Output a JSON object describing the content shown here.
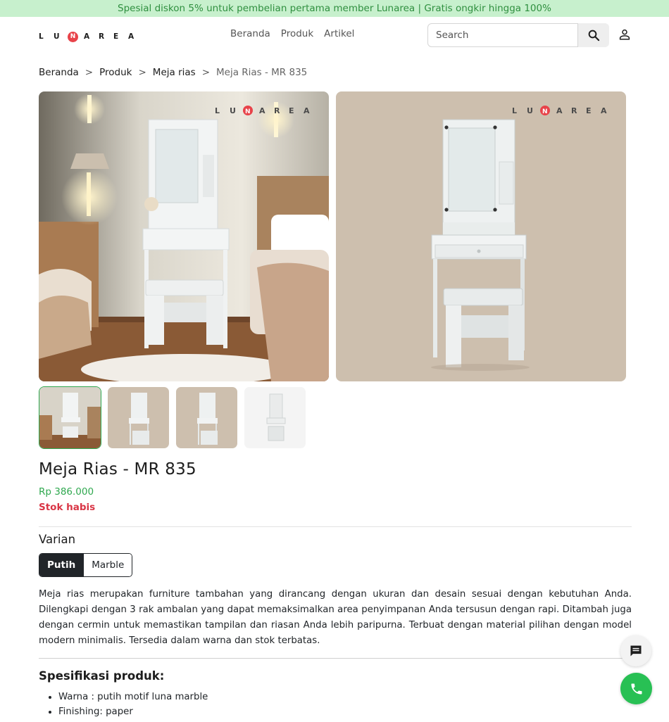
{
  "promo_text": "Spesial diskon 5% untuk pembelian pertama member Lunarea | Gratis ongkir hingga 100%",
  "brand": {
    "letters": [
      "L",
      "U",
      "N",
      "A",
      "R",
      "E",
      "A"
    ],
    "accent": "#e8434a"
  },
  "nav": [
    "Beranda",
    "Produk",
    "Artikel"
  ],
  "search": {
    "placeholder": "Search"
  },
  "breadcrumb": {
    "items": [
      "Beranda",
      "Produk",
      "Meja rias"
    ],
    "separator": ">",
    "current": "Meja Rias - MR 835"
  },
  "product": {
    "title": "Meja Rias - MR 835",
    "price": "Rp 386.000",
    "stock": "Stok habis",
    "variant_label": "Varian",
    "variants": [
      "Putih",
      "Marble"
    ],
    "selected_variant": "Putih",
    "description": "Meja rias merupakan furniture tambahan yang dirancang dengan ukuran dan desain sesuai dengan kebutuhan Anda. Dilengkapi dengan 3 rak ambalan yang dapat memaksimalkan area penyimpanan Anda tersusun dengan rapi. Ditambah juga dengan cermin untuk memastikan tampilan dan riasan Anda lebih paripurna. Terbuat dengan material pilihan dengan model modern minimalis. Tersedia dalam warna dan stok terbatas.",
    "specs_title": "Spesifikasi produk:",
    "specs": [
      "Warna : putih motif luna marble",
      "Finishing: paper"
    ]
  },
  "colors": {
    "price": "#2fa84f",
    "stock_out": "#d93545",
    "promo_bg": "#c7f0cd",
    "call": "#28c054"
  },
  "icons": {
    "search": "search-icon",
    "user": "user-icon",
    "chat": "chat-icon",
    "call": "phone-icon"
  }
}
